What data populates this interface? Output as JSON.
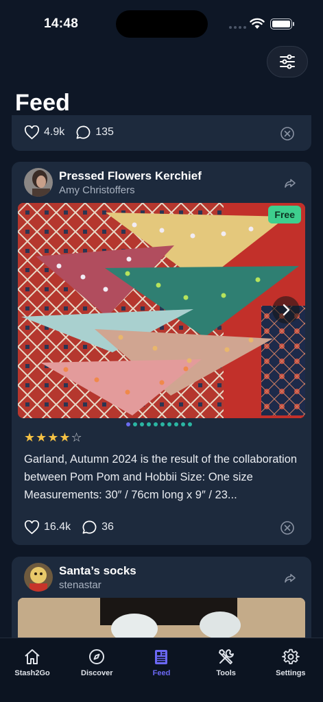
{
  "status": {
    "time": "14:48"
  },
  "page": {
    "title": "Feed"
  },
  "prev_post": {
    "likes": "4.9k",
    "comments": "135"
  },
  "post": {
    "title": "Pressed Flowers Kerchief",
    "author": "Amy Christoffers",
    "badge": "Free",
    "rating": 4,
    "rating_max": 5,
    "stars_filled": "★★★★",
    "stars_empty": "☆",
    "description": "Garland, Autumn 2024 is the result of the collaboration between Pom Pom and Hobbii Size: One size Measurements: 30″ / 76cm long x 9″ / 23...",
    "likes": "16.4k",
    "comments": "36",
    "image_count": 10,
    "image_index": 1
  },
  "next_post": {
    "title": "Santa’s socks",
    "author": "stenastar"
  },
  "tabs": [
    {
      "label": "Stash2Go",
      "icon": "home-icon"
    },
    {
      "label": "Discover",
      "icon": "compass-icon"
    },
    {
      "label": "Feed",
      "icon": "newspaper-icon",
      "active": true
    },
    {
      "label": "Tools",
      "icon": "tools-icon"
    },
    {
      "label": "Settings",
      "icon": "gear-icon"
    }
  ],
  "colors": {
    "accent": "#6b68f4",
    "badge": "#3ecf8e",
    "card": "#1d2a3d",
    "background": "#0e1726",
    "star": "#f6c244"
  }
}
